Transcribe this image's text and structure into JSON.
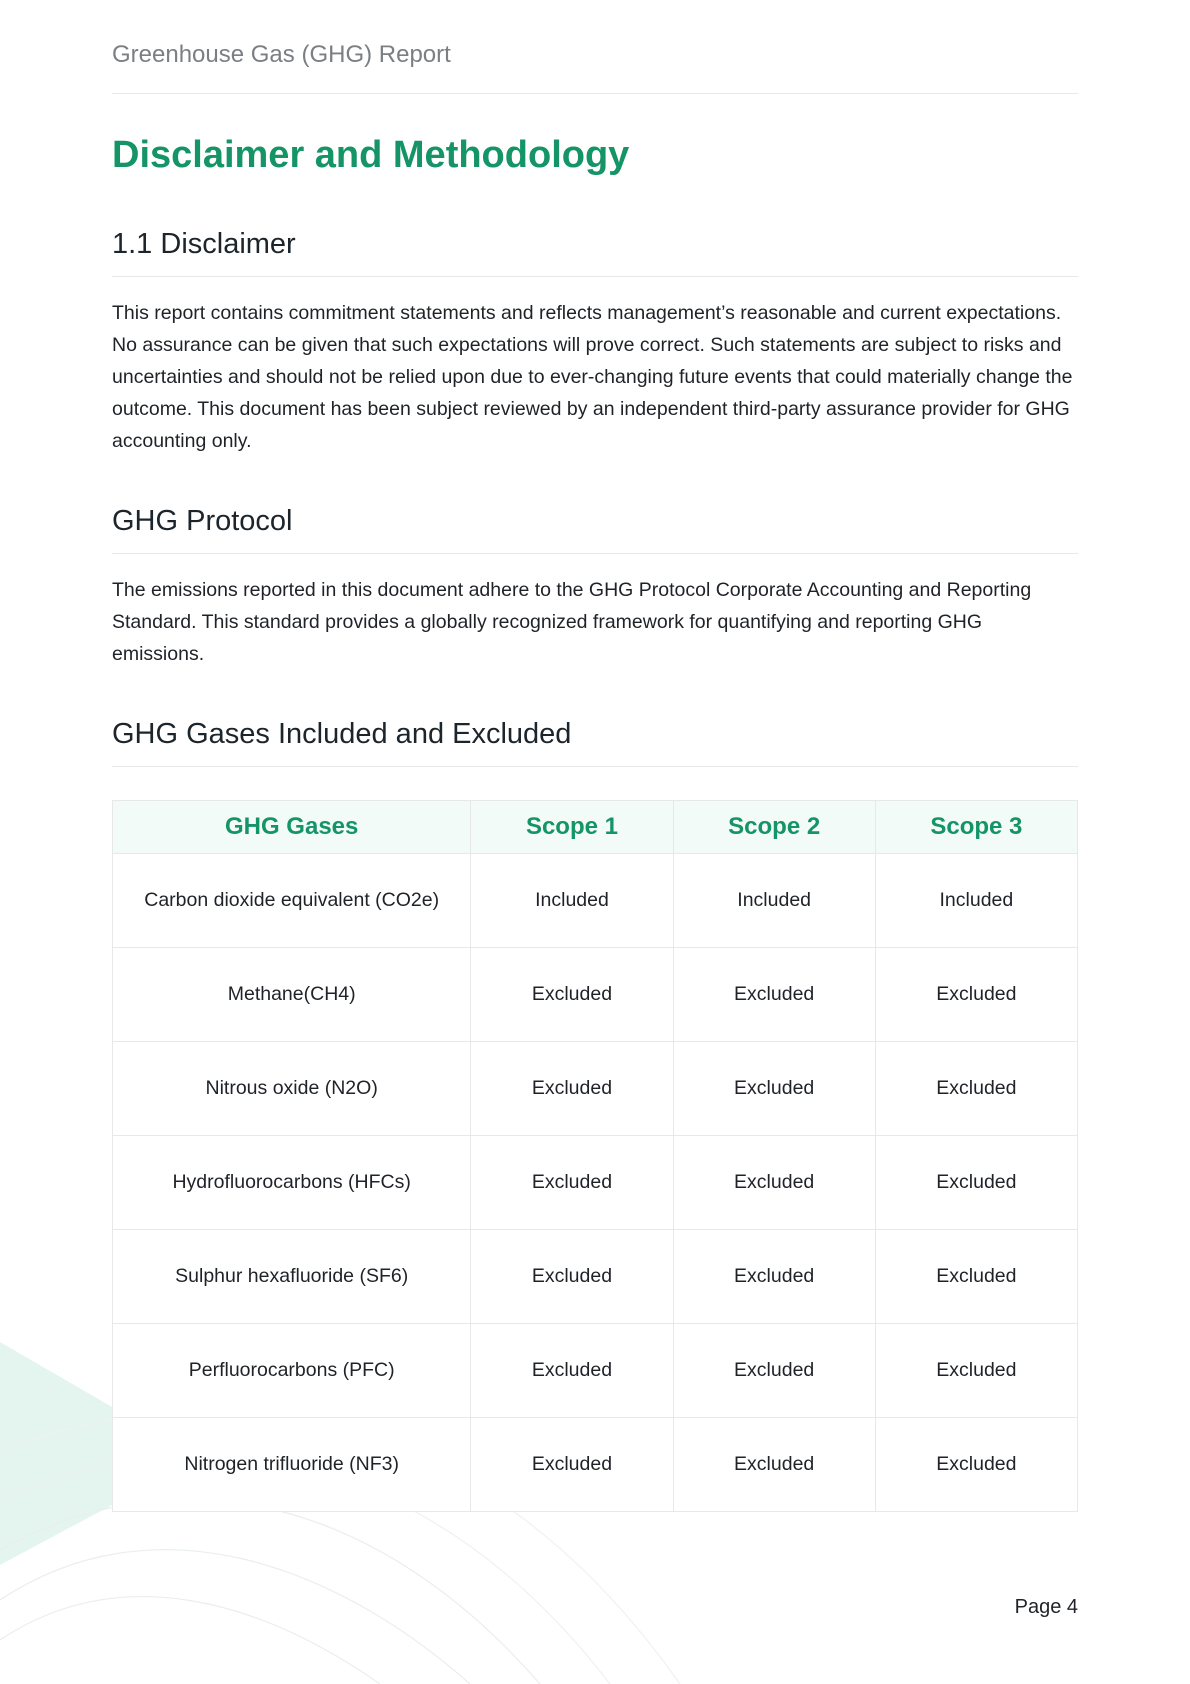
{
  "header": {
    "title": "Greenhouse Gas (GHG) Report"
  },
  "main": {
    "title": "Disclaimer and Methodology",
    "sections": [
      {
        "title": "1.1 Disclaimer",
        "body": "This report contains commitment statements and reflects management’s reasonable and current expectations. No assurance can be given that such expectations will prove correct. Such statements are subject to risks and uncertainties and should not be relied upon due to ever-changing future events that could materially change the outcome. This document has been subject reviewed by an independent third-party assurance provider for GHG accounting only."
      },
      {
        "title": "GHG Protocol",
        "body": "The emissions reported in this document adhere to the GHG Protocol Corporate Accounting and Reporting Standard. This standard provides a globally recognized framework for quantifying and reporting GHG emissions."
      },
      {
        "title": "GHG Gases Included and Excluded"
      }
    ]
  },
  "table": {
    "headers": [
      "GHG Gases",
      "Scope 1",
      "Scope 2",
      "Scope 3"
    ],
    "rows": [
      [
        "Carbon dioxide equivalent (CO2e)",
        "Included",
        "Included",
        "Included"
      ],
      [
        "Methane(CH4)",
        "Excluded",
        "Excluded",
        "Excluded"
      ],
      [
        "Nitrous oxide (N2O)",
        "Excluded",
        "Excluded",
        "Excluded"
      ],
      [
        "Hydrofluorocarbons (HFCs)",
        "Excluded",
        "Excluded",
        "Excluded"
      ],
      [
        "Sulphur hexafluoride (SF6)",
        "Excluded",
        "Excluded",
        "Excluded"
      ],
      [
        "Perfluorocarbons (PFC)",
        "Excluded",
        "Excluded",
        "Excluded"
      ],
      [
        "Nitrogen trifluoride (NF3)",
        "Excluded",
        "Excluded",
        "Excluded"
      ]
    ]
  },
  "footer": {
    "page_label": "Page 4"
  },
  "colors": {
    "accent": "#149467",
    "header_fill": "#f3fbf8",
    "decor_fill": "#e3f5ee"
  }
}
